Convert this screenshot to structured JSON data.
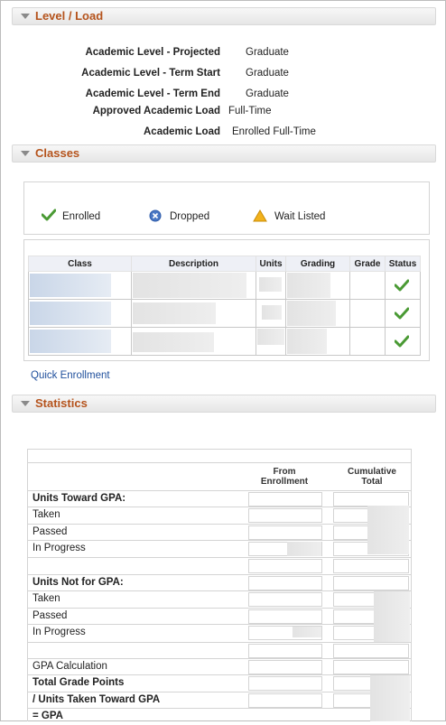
{
  "level_load": {
    "title": "Level / Load",
    "rows": [
      {
        "label": "Academic Level - Projected",
        "value": "Graduate"
      },
      {
        "label": "Academic Level - Term Start",
        "value": "Graduate"
      },
      {
        "label": "Academic Level - Term End",
        "value": "Graduate"
      },
      {
        "label": "Approved Academic Load",
        "value": "Full-Time"
      },
      {
        "label": "Academic Load",
        "value": "Enrolled Full-Time"
      }
    ]
  },
  "classes": {
    "title": "Classes",
    "legend": {
      "enrolled": "Enrolled",
      "dropped": "Dropped",
      "wait_listed": "Wait Listed"
    },
    "columns": [
      "Class",
      "Description",
      "Units",
      "Grading",
      "Grade",
      "Status"
    ],
    "row_status_icons": [
      "check-icon",
      "check-icon",
      "check-icon"
    ],
    "link": "Quick Enrollment"
  },
  "statistics": {
    "title": "Statistics",
    "col_from": "From Enrollment",
    "col_cumulative": "Cumulative Total",
    "rows": [
      {
        "text": "Units Toward GPA:",
        "bold": true
      },
      {
        "text": "Taken",
        "bold": false
      },
      {
        "text": "Passed",
        "bold": false
      },
      {
        "text": "In Progress",
        "bold": false
      },
      {
        "text": "",
        "bold": false
      },
      {
        "text": "Units Not for GPA:",
        "bold": true
      },
      {
        "text": "Taken",
        "bold": false
      },
      {
        "text": "Passed",
        "bold": false
      },
      {
        "text": "In Progress",
        "bold": false
      },
      {
        "text": "",
        "bold": false
      },
      {
        "text": "GPA Calculation",
        "bold": false
      },
      {
        "text": "Total Grade Points",
        "bold": true
      },
      {
        "text": "/  Units Taken Toward GPA",
        "bold": true
      },
      {
        "text": "= GPA",
        "bold": true
      }
    ]
  },
  "colors": {
    "section_title": "#b5531c",
    "link": "#1f4f9c",
    "check": "#4a9a34",
    "dropped": "#4a78c4",
    "warning": "#f2b21d"
  }
}
